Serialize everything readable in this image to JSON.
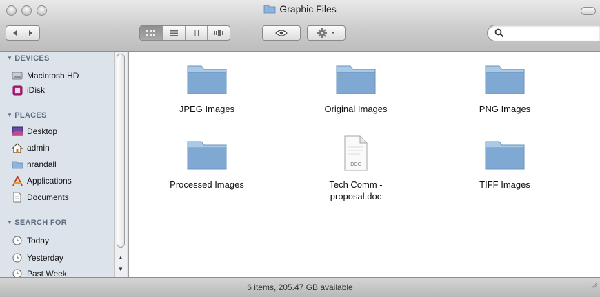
{
  "window": {
    "title": "Graphic Files"
  },
  "toolbar": {
    "back_icon": "chevron-left-icon",
    "forward_icon": "chevron-right-icon",
    "view_modes": [
      "icon-view-icon",
      "list-view-icon",
      "column-view-icon",
      "coverflow-view-icon"
    ],
    "quicklook_icon": "eye-icon",
    "action_icon": "gear-icon",
    "search": {
      "placeholder": "",
      "value": ""
    }
  },
  "sidebar": {
    "sections": [
      {
        "title": "DEVICES",
        "items": [
          {
            "label": "Macintosh HD",
            "icon": "hard-drive-icon"
          },
          {
            "label": "iDisk",
            "icon": "idisk-icon"
          }
        ]
      },
      {
        "title": "PLACES",
        "items": [
          {
            "label": "Desktop",
            "icon": "desktop-icon"
          },
          {
            "label": "admin",
            "icon": "home-icon"
          },
          {
            "label": "nrandall",
            "icon": "folder-icon"
          },
          {
            "label": "Applications",
            "icon": "applications-icon"
          },
          {
            "label": "Documents",
            "icon": "document-icon"
          }
        ]
      },
      {
        "title": "SEARCH FOR",
        "items": [
          {
            "label": "Today",
            "icon": "clock-icon"
          },
          {
            "label": "Yesterday",
            "icon": "clock-icon"
          },
          {
            "label": "Past Week",
            "icon": "clock-icon"
          }
        ]
      }
    ]
  },
  "files": [
    {
      "label": "JPEG Images",
      "type": "folder"
    },
    {
      "label": "Original Images",
      "type": "folder"
    },
    {
      "label": "PNG Images",
      "type": "folder"
    },
    {
      "label": "Processed Images",
      "type": "folder"
    },
    {
      "label": "Tech Comm -\nproposal.doc",
      "type": "document",
      "badge": "DOC"
    },
    {
      "label": "TIFF Images",
      "type": "folder"
    }
  ],
  "status": {
    "text": "6 items, 205.47 GB available"
  },
  "colors": {
    "folder_top": "#a9c9e6",
    "folder_body": "#7fa8d3",
    "sidebar_bg": "#dde3ea",
    "sidebar_heading": "#5d6c80"
  }
}
